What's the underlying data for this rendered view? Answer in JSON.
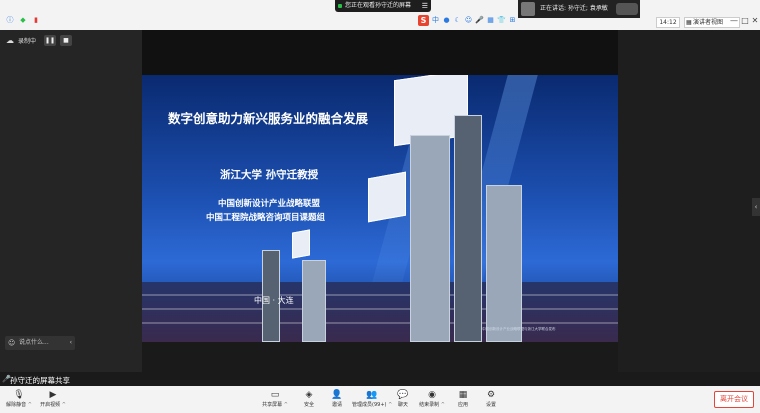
{
  "top_bar": {
    "share_banner": "您正在观看孙守迁的屏幕",
    "menu_glyph": "☰",
    "speaking": "正在讲话: 孙守迁; 袁承敏",
    "clock": "14:12",
    "view_button": "演讲者视图",
    "ime_glyphs": [
      "中",
      "●",
      "☾",
      "☺",
      "🎤",
      "▦",
      "👕",
      "⊞"
    ],
    "window_controls": [
      "—",
      "□",
      "✕"
    ]
  },
  "recording": {
    "label": "录制中",
    "pause_glyph": "❚❚",
    "stop_glyph": "■"
  },
  "chat": {
    "placeholder": "说点什么...",
    "chevron": "‹"
  },
  "slide": {
    "title": "数字创意助力新兴服务业的融合发展",
    "speaker": "浙江大学 孙守迁教授",
    "org1": "中国创新设计产业战略联盟",
    "org2": "中国工程院战略咨询项目课题组",
    "place": "中国 · 大连",
    "fine_print": "中国创新设计产业战略联盟与浙江大学联合发布"
  },
  "sharing_label": "孙守迁的屏幕共享",
  "toolbar": {
    "unmute": "解除静音",
    "start_video": "开启视频",
    "share_screen": "共享屏幕",
    "security": "安全",
    "invite": "邀请",
    "participants": "管理成员(99+)",
    "chat": "聊天",
    "end_recording": "结束录制",
    "apps": "应用",
    "settings": "设置",
    "leave": "离开会议"
  },
  "colors": {
    "accent": "#2a7ae2",
    "leave": "#e2463a",
    "recording": "#2bbf4a"
  }
}
